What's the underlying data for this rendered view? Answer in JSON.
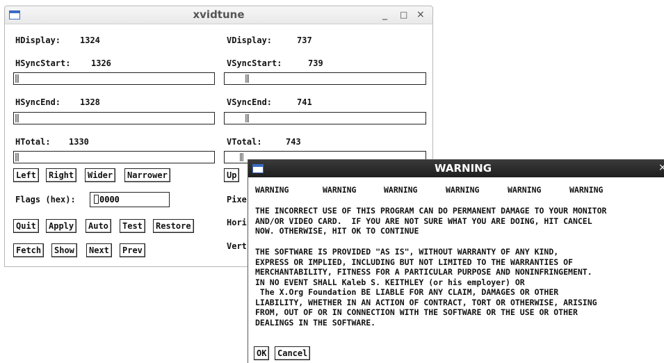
{
  "main_window": {
    "title": "xvidtune",
    "controls": {
      "minimize": "_",
      "maximize": "□",
      "close": "×"
    },
    "h": {
      "display_label": "HDisplay:",
      "display_value": "1324",
      "syncstart_label": "HSyncStart:",
      "syncstart_value": "1326",
      "syncend_label": "HSyncEnd:",
      "syncend_value": "1328",
      "total_label": "HTotal:",
      "total_value": "1330"
    },
    "v": {
      "display_label": "VDisplay:",
      "display_value": "737",
      "syncstart_label": "VSyncStart:",
      "syncstart_value": "739",
      "syncend_label": "VSyncEnd:",
      "syncend_value": "741",
      "total_label": "VTotal:",
      "total_value": "743"
    },
    "h_buttons": {
      "left": "Left",
      "right": "Right",
      "wider": "Wider",
      "narrower": "Narrower"
    },
    "v_buttons": {
      "up": "Up"
    },
    "flags_label": "Flags (hex):",
    "flags_value": "0000",
    "action_buttons": {
      "quit": "Quit",
      "apply": "Apply",
      "auto": "Auto",
      "test": "Test",
      "restore": "Restore"
    },
    "fetch_buttons": {
      "fetch": "Fetch",
      "show": "Show",
      "next": "Next",
      "prev": "Prev"
    },
    "partial_labels": {
      "pixel": "Pixe",
      "horizontal": "Hori",
      "vertical": "Vert"
    }
  },
  "warning_window": {
    "title": "WARNING",
    "close": "×",
    "header_words": [
      "WARNING",
      "WARNING",
      "WARNING",
      "WARNING",
      "WARNING",
      "WARNING"
    ],
    "para1": [
      "THE INCORRECT USE OF THIS PROGRAM CAN DO PERMANENT DAMAGE TO YOUR MONITOR",
      "AND/OR VIDEO CARD.  IF YOU ARE NOT SURE WHAT YOU ARE DOING, HIT CANCEL",
      "NOW. OTHERWISE, HIT OK TO CONTINUE"
    ],
    "para2": [
      "THE SOFTWARE IS PROVIDED \"AS IS\", WITHOUT WARRANTY OF ANY KIND,",
      "EXPRESS OR IMPLIED, INCLUDING BUT NOT LIMITED TO THE WARRANTIES OF",
      "MERCHANTABILITY, FITNESS FOR A PARTICULAR PURPOSE AND NONINFRINGEMENT.",
      "IN NO EVENT SHALL Kaleb S. KEITHLEY (or his employer) OR",
      " The X.Org Foundation BE LIABLE FOR ANY CLAIM, DAMAGES OR OTHER",
      "LIABILITY, WHETHER IN AN ACTION OF CONTRACT, TORT OR OTHERWISE, ARISING",
      "FROM, OUT OF OR IN CONNECTION WITH THE SOFTWARE OR THE USE OR OTHER",
      "DEALINGS IN THE SOFTWARE."
    ],
    "ok": "OK",
    "cancel": "Cancel"
  }
}
